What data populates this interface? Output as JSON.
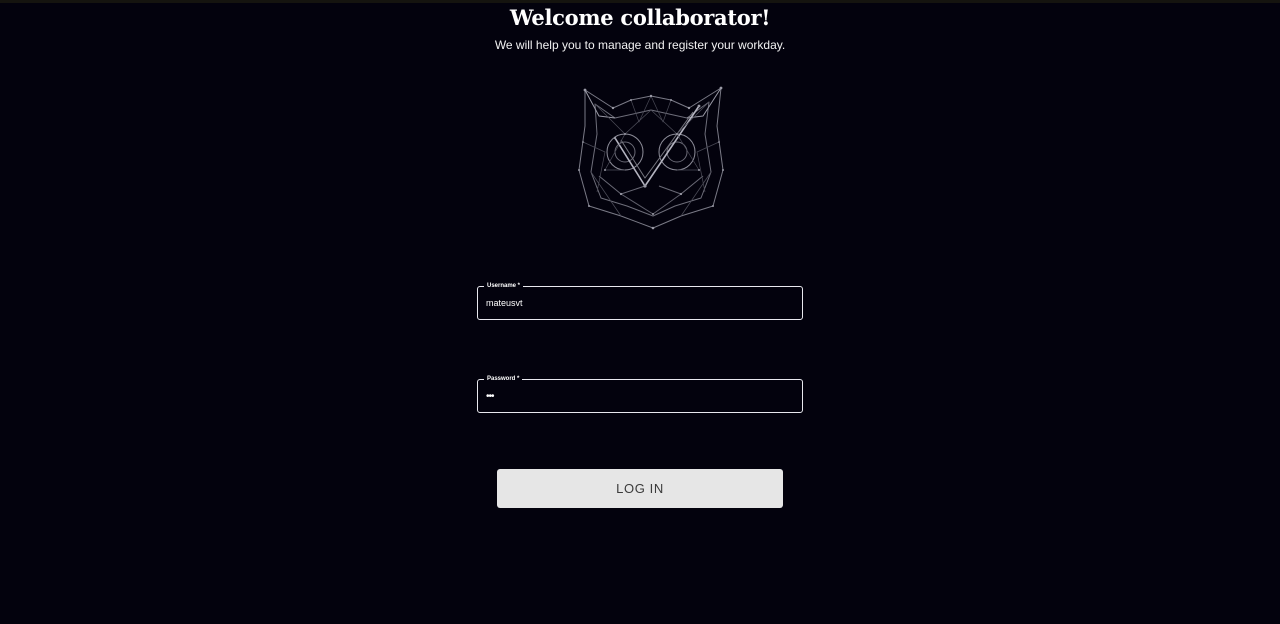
{
  "header": {
    "title": "Welcome collaborator!",
    "subtitle": "We will help you to manage and register your workday."
  },
  "logo": {
    "icon": "owl-checkmark-logo-icon"
  },
  "form": {
    "username": {
      "label": "Username *",
      "value": "mateusvt"
    },
    "password": {
      "label": "Password *",
      "value": "•••"
    },
    "login_label": "LOG IN"
  },
  "colors": {
    "background": "#03020d",
    "field_border": "#e8e8ee",
    "button_bg": "#e6e6e6",
    "button_text": "#3b3b3b"
  }
}
